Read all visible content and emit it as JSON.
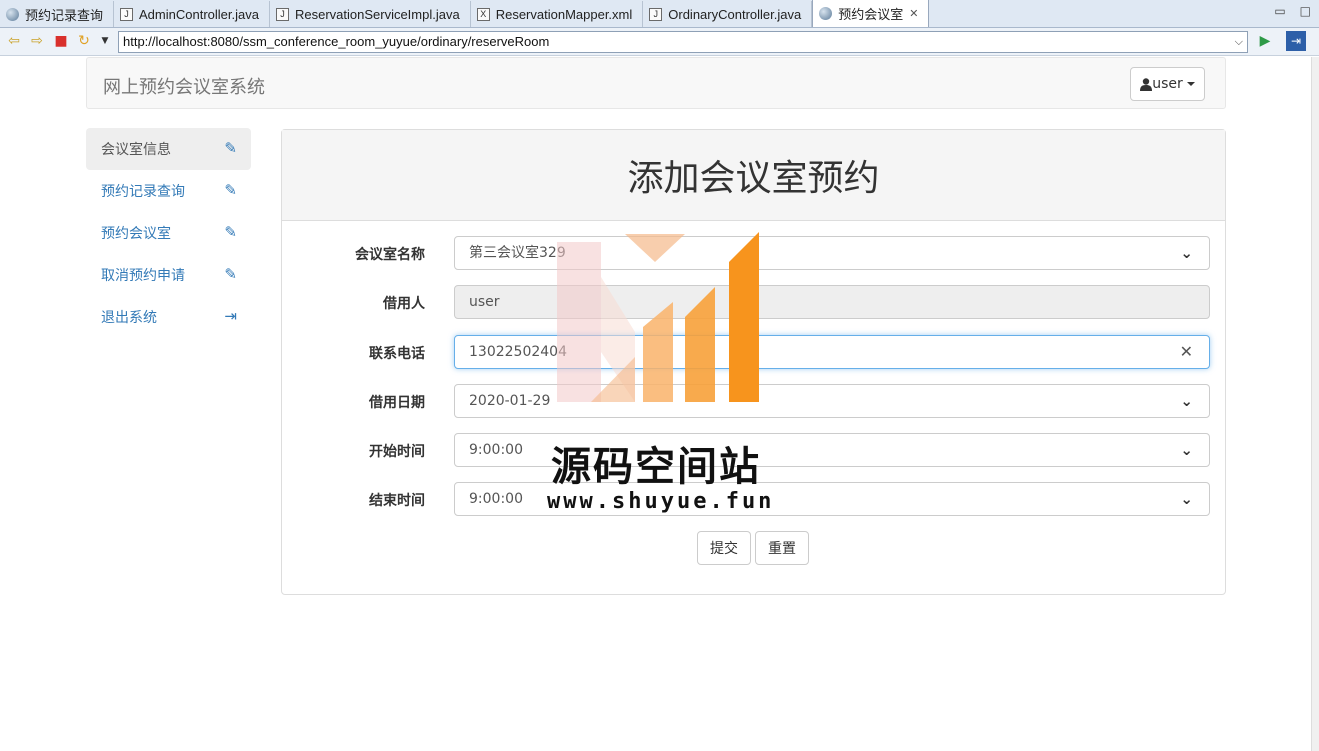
{
  "ide_tabs": [
    {
      "label": "预约记录查询",
      "icon": "globe-icon",
      "active": false
    },
    {
      "label": "AdminController.java",
      "icon": "java-file-icon",
      "active": false
    },
    {
      "label": "ReservationServiceImpl.java",
      "icon": "java-file-icon",
      "active": false
    },
    {
      "label": "ReservationMapper.xml",
      "icon": "xml-file-icon",
      "active": false
    },
    {
      "label": "OrdinaryController.java",
      "icon": "java-file-icon",
      "active": false
    },
    {
      "label": "预约会议室",
      "icon": "globe-icon",
      "active": true
    }
  ],
  "address": {
    "url": "http://localhost:8080/ssm_conference_room_yuyue/ordinary/reserveRoom"
  },
  "navbar": {
    "brand": "网上预约会议室系统",
    "user_label": "user"
  },
  "sidebar": {
    "items": [
      {
        "label": "会议室信息",
        "icon": "pencil-icon",
        "active": true
      },
      {
        "label": "预约记录查询",
        "icon": "pencil-icon",
        "active": false
      },
      {
        "label": "预约会议室",
        "icon": "pencil-icon",
        "active": false
      },
      {
        "label": "取消预约申请",
        "icon": "pencil-icon",
        "active": false
      },
      {
        "label": "退出系统",
        "icon": "logout-icon",
        "active": false
      }
    ]
  },
  "form": {
    "title": "添加会议室预约",
    "fields": [
      {
        "label": "会议室名称",
        "value": "第三会议室329"
      },
      {
        "label": "借用人",
        "value": "user"
      },
      {
        "label": "联系电话",
        "value": "13022502404"
      },
      {
        "label": "借用日期",
        "value": "2020-01-29"
      },
      {
        "label": "开始时间",
        "value": "9:00:00"
      },
      {
        "label": "结束时间",
        "value": "9:00:00"
      }
    ],
    "submit_label": "提交",
    "reset_label": "重置"
  },
  "watermark": {
    "name": "源码空间站",
    "site": "www.shuyue.fun"
  },
  "colors": {
    "link": "#337ab7",
    "focus": "#66afe9",
    "watermark_orange": "#f7941d"
  }
}
